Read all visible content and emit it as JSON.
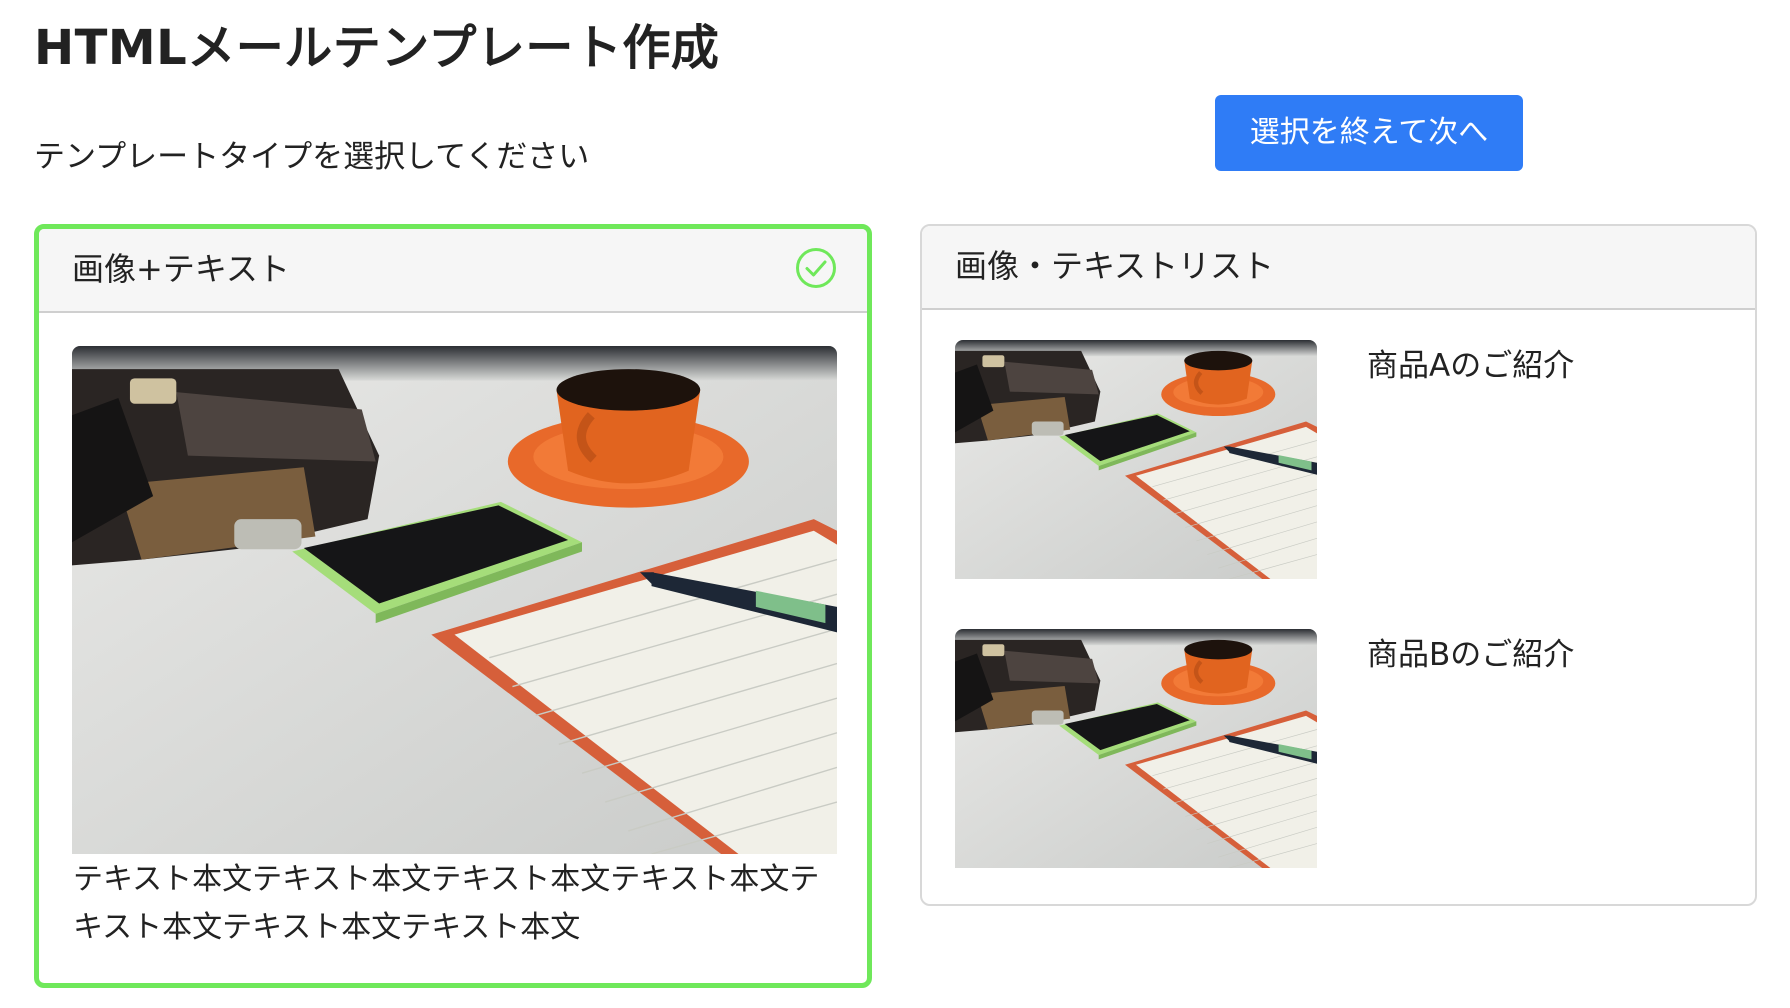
{
  "page": {
    "title": "HTMLメールテンプレート作成",
    "subtitle": "テンプレートタイプを選択してください",
    "next_button_label": "選択を終えて次へ"
  },
  "colors": {
    "selected_border": "#6fe85a",
    "check_icon": "#6fe85a",
    "primary_button": "#2f7cf6",
    "card_header_bg": "#f6f6f6"
  },
  "templates": [
    {
      "title": "画像+テキスト",
      "selected": true,
      "status_icon": "check-circle-icon",
      "image": "desk-photo (coffee cup, smartphone, notebook, pen, wallet)",
      "body_text": "テキスト本文テキスト本文テキスト本文テキスト本文テキスト本文テキスト本文テキスト本文"
    },
    {
      "title": "画像・テキストリスト",
      "selected": false,
      "items": [
        {
          "title": "商品Aのご紹介",
          "image": "desk-photo"
        },
        {
          "title": "商品Bのご紹介",
          "image": "desk-photo"
        }
      ]
    }
  ]
}
